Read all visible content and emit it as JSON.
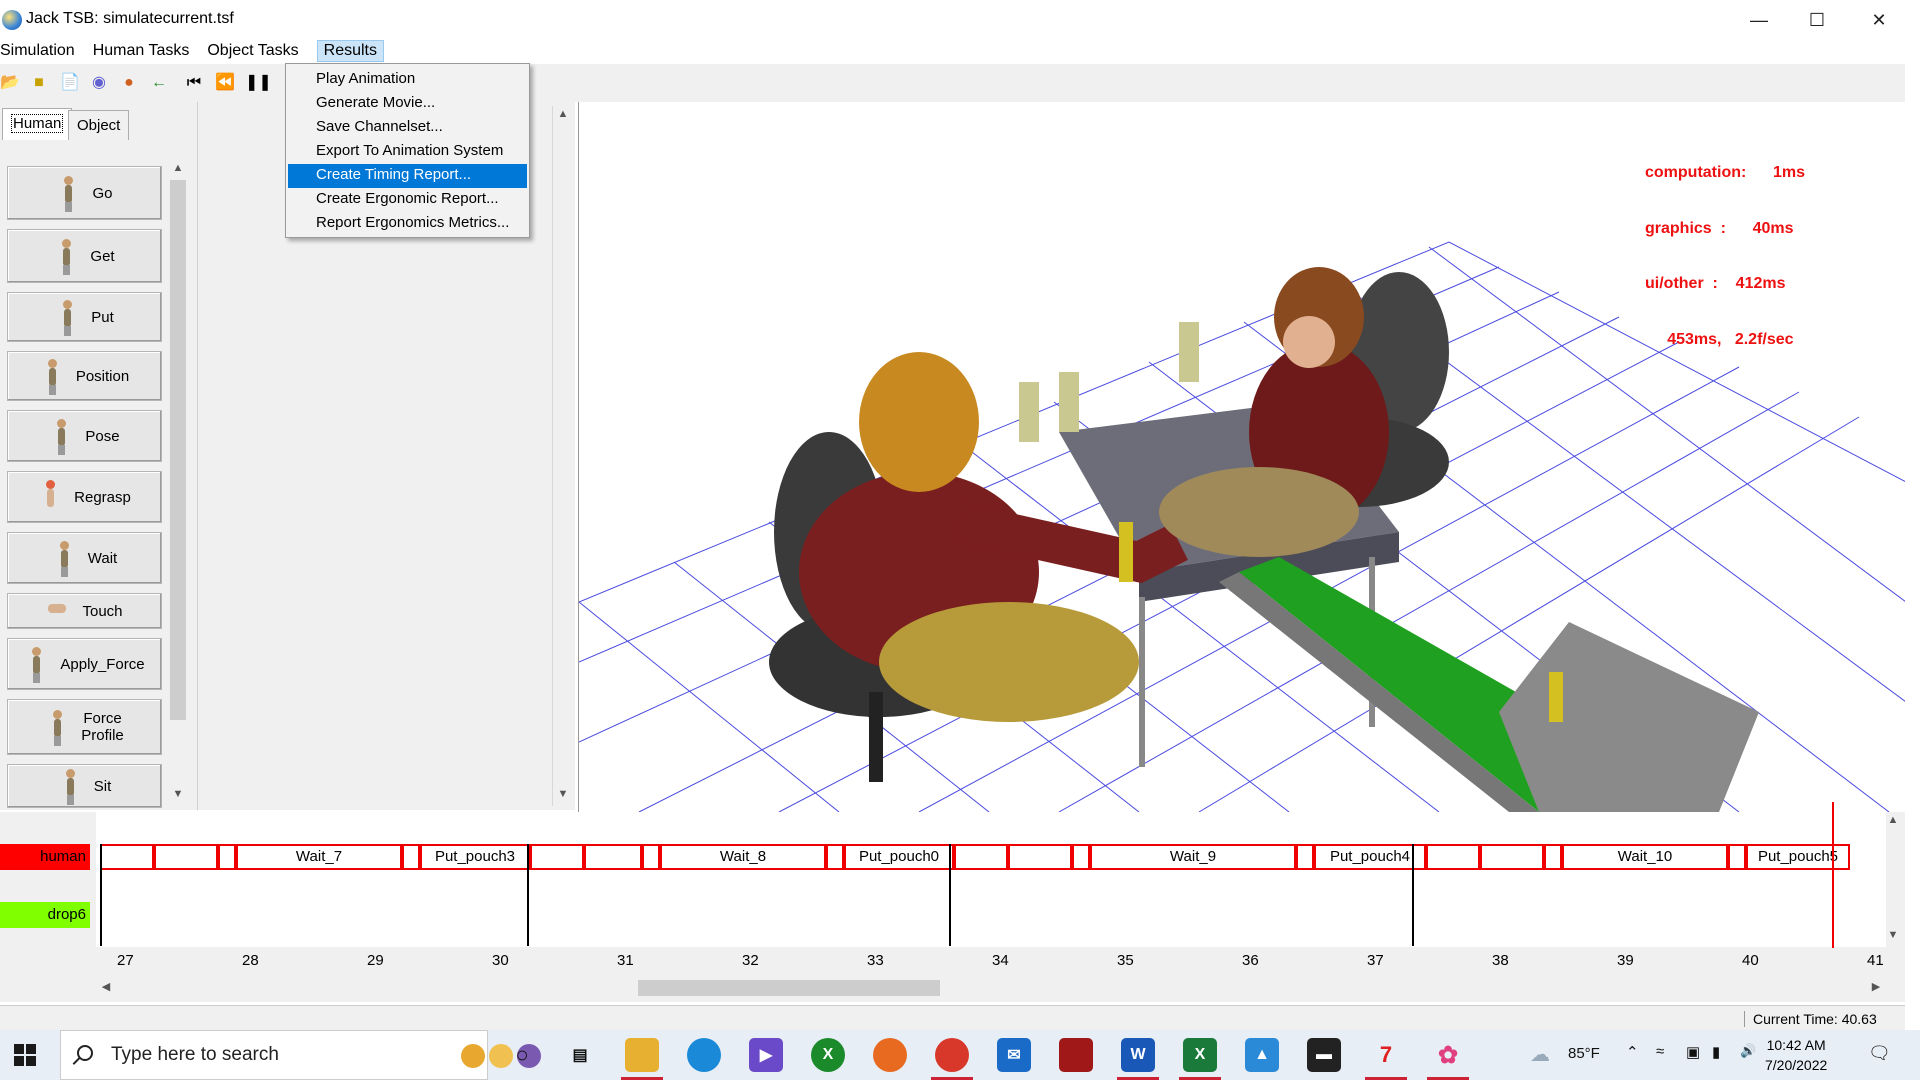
{
  "window": {
    "title": "Jack TSB:  simulatecurrent.tsf"
  },
  "menubar": [
    "Simulation",
    "Human Tasks",
    "Object Tasks",
    "Results"
  ],
  "results_menu": [
    "Play Animation",
    "Generate Movie...",
    "Save Channelset...",
    "Export To Animation System",
    "Create Timing Report...",
    "Create Ergonomic Report...",
    "Report Ergonomics Metrics..."
  ],
  "tabs": {
    "human": "Human",
    "object": "Object"
  },
  "tasks": [
    "Go",
    "Get",
    "Put",
    "Position",
    "Pose",
    "Regrasp",
    "Wait",
    "Touch",
    "Apply_Force",
    "Force\nProfile",
    "Sit"
  ],
  "stats": {
    "line1": "computation:      1ms",
    "line2": "graphics  :      40ms",
    "line3": "ui/other  :    412ms",
    "line4": "     453ms,   2.2f/sec"
  },
  "timeline": {
    "tracks": {
      "human": "human",
      "drop": "drop6"
    },
    "segments": [
      "Wait_7",
      "Put_pouch3",
      "Wait_8",
      "Put_pouch0",
      "Wait_9",
      "Put_pouch4",
      "Wait_10",
      "Put_pouch5"
    ],
    "ticks": [
      "27",
      "28",
      "29",
      "30",
      "31",
      "32",
      "33",
      "34",
      "35",
      "36",
      "37",
      "38",
      "39",
      "40",
      "41"
    ],
    "colors": {
      "human_track": "#ff0000",
      "drop_track": "#7fff00",
      "segment_border": "#e00000"
    }
  },
  "status": {
    "current_time": "Current Time: 40.63"
  },
  "taskbar": {
    "search_placeholder": "Type here to search",
    "weather": "85°F",
    "time": "10:42 AM",
    "date": "7/20/2022"
  },
  "icons": [
    "open-icon",
    "save-icon",
    "new-icon",
    "object-icon",
    "human-icon",
    "back-arrow-icon",
    "skip-start-icon",
    "rewind-icon",
    "pause-icon"
  ]
}
